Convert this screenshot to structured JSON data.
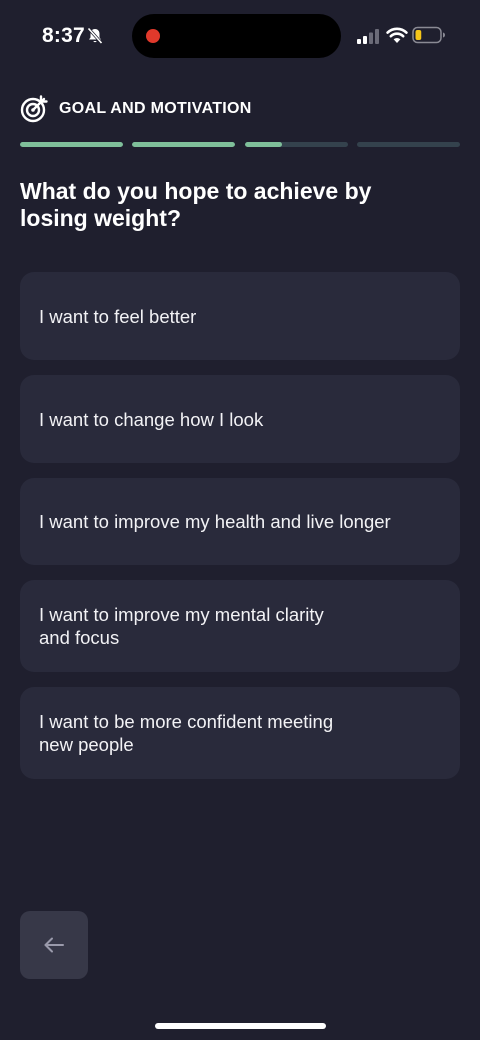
{
  "status_bar": {
    "time": "8:37",
    "icons": [
      "bell-slash-icon",
      "signal-icon",
      "wifi-icon",
      "battery-icon"
    ],
    "battery_level": 0.25,
    "recording_indicator_color": "#e0392b"
  },
  "header": {
    "icon": "target-icon",
    "title": "GOAL AND MOTIVATION"
  },
  "progress": {
    "segments": [
      1.0,
      1.0,
      0.36,
      0.0
    ],
    "fill_color": "#7fbf9a",
    "track_color": "#34424d"
  },
  "question": "What do you hope to achieve by losing weight?",
  "options": [
    {
      "label": "I want to feel better"
    },
    {
      "label": "I want to change how I look"
    },
    {
      "label": "I want to improve my health and live longer"
    },
    {
      "label": "I want to improve my mental clarity\nand focus"
    },
    {
      "label": "I want to be more confident meeting\nnew people"
    }
  ],
  "back_button": {
    "icon": "arrow-left-icon"
  },
  "colors": {
    "background": "#1f1f2e",
    "card": "#292a3b",
    "back_button": "#373848",
    "accent": "#7fbf9a"
  }
}
